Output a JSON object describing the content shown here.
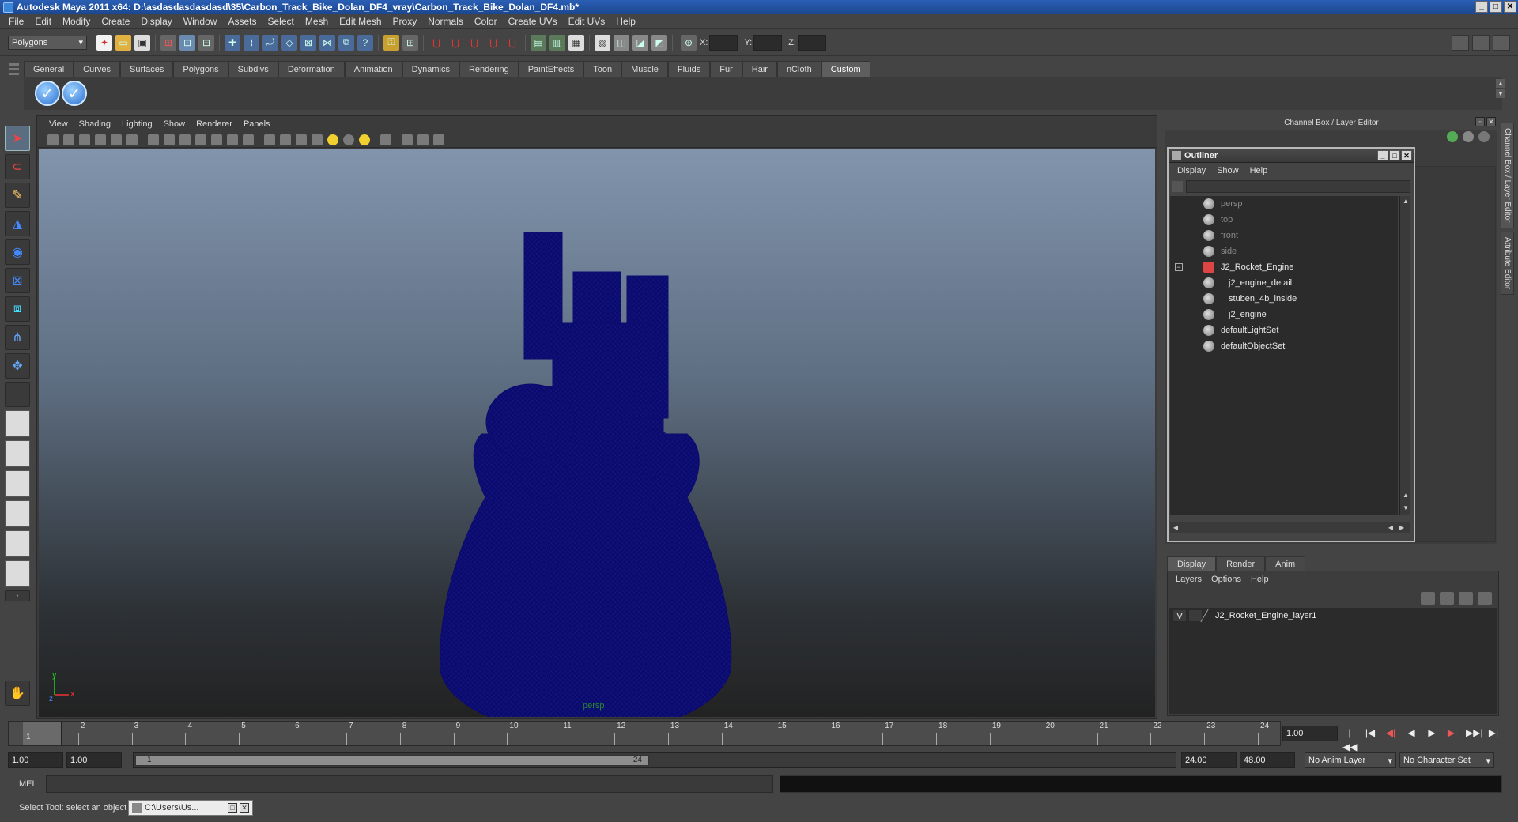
{
  "window": {
    "title": "Autodesk Maya 2011 x64: D:\\asdasdasdasdasd\\35\\Carbon_Track_Bike_Dolan_DF4_vray\\Carbon_Track_Bike_Dolan_DF4.mb*",
    "minimize": "_",
    "maximize": "□",
    "close": "✕"
  },
  "menu": [
    "File",
    "Edit",
    "Modify",
    "Create",
    "Display",
    "Window",
    "Assets",
    "Select",
    "Mesh",
    "Edit Mesh",
    "Proxy",
    "Normals",
    "Color",
    "Create UVs",
    "Edit UVs",
    "Help"
  ],
  "status": {
    "mode": "Polygons",
    "x_label": "X:",
    "y_label": "Y:",
    "z_label": "Z:"
  },
  "shelf": {
    "tabs": [
      "General",
      "Curves",
      "Surfaces",
      "Polygons",
      "Subdivs",
      "Deformation",
      "Animation",
      "Dynamics",
      "Rendering",
      "PaintEffects",
      "Toon",
      "Muscle",
      "Fluids",
      "Fur",
      "Hair",
      "nCloth",
      "Custom"
    ],
    "active_tab": "Custom",
    "button_glyph": "✓"
  },
  "viewport": {
    "menu": [
      "View",
      "Shading",
      "Lighting",
      "Show",
      "Renderer",
      "Panels"
    ],
    "camera": "persp",
    "axis_y": "y",
    "axis_x": "x",
    "axis_z": "z",
    "wire_color": "#0b0b6e"
  },
  "channel_box": {
    "title": "Channel Box / Layer Editor"
  },
  "side_tabs": [
    "Channel Box / Layer Editor",
    "Attribute Editor"
  ],
  "outliner": {
    "title": "Outliner",
    "menu": [
      "Display",
      "Show",
      "Help"
    ],
    "items": [
      {
        "label": "persp",
        "dim": true
      },
      {
        "label": "top",
        "dim": true
      },
      {
        "label": "front",
        "dim": true
      },
      {
        "label": "side",
        "dim": true
      },
      {
        "label": "J2_Rocket_Engine",
        "dim": false
      },
      {
        "label": "j2_engine_detail",
        "dim": false
      },
      {
        "label": "stuben_4b_inside",
        "dim": false
      },
      {
        "label": "j2_engine",
        "dim": false
      },
      {
        "label": "defaultLightSet",
        "dim": false
      },
      {
        "label": "defaultObjectSet",
        "dim": false
      }
    ],
    "expander": "−"
  },
  "layer_editor": {
    "tabs": [
      "Display",
      "Render",
      "Anim"
    ],
    "menu": [
      "Layers",
      "Options",
      "Help"
    ],
    "layers": [
      {
        "visible": "V",
        "name": "J2_Rocket_Engine_layer1"
      }
    ]
  },
  "timeline": {
    "ticks": [
      1,
      2,
      3,
      4,
      5,
      6,
      7,
      8,
      9,
      10,
      11,
      12,
      13,
      14,
      15,
      16,
      17,
      18,
      19,
      20,
      21,
      22,
      23,
      24
    ],
    "current_frame_label": "1",
    "current_time": "1.00",
    "playback_glyphs": [
      "|◀◀",
      "|◀",
      "◀|",
      "◀",
      "▶",
      "▶|",
      "▶▶|",
      "▶|"
    ]
  },
  "range": {
    "start_time": "1.00",
    "playback_start": "1.00",
    "handle_start": "1",
    "handle_end": "24",
    "playback_end": "24.00",
    "end_time": "48.00",
    "anim_layer": "No Anim Layer",
    "character_set": "No Character Set"
  },
  "command": {
    "label": "MEL"
  },
  "help": {
    "text": "Select Tool: select an object",
    "taskbar": "C:\\Users\\Us..."
  }
}
